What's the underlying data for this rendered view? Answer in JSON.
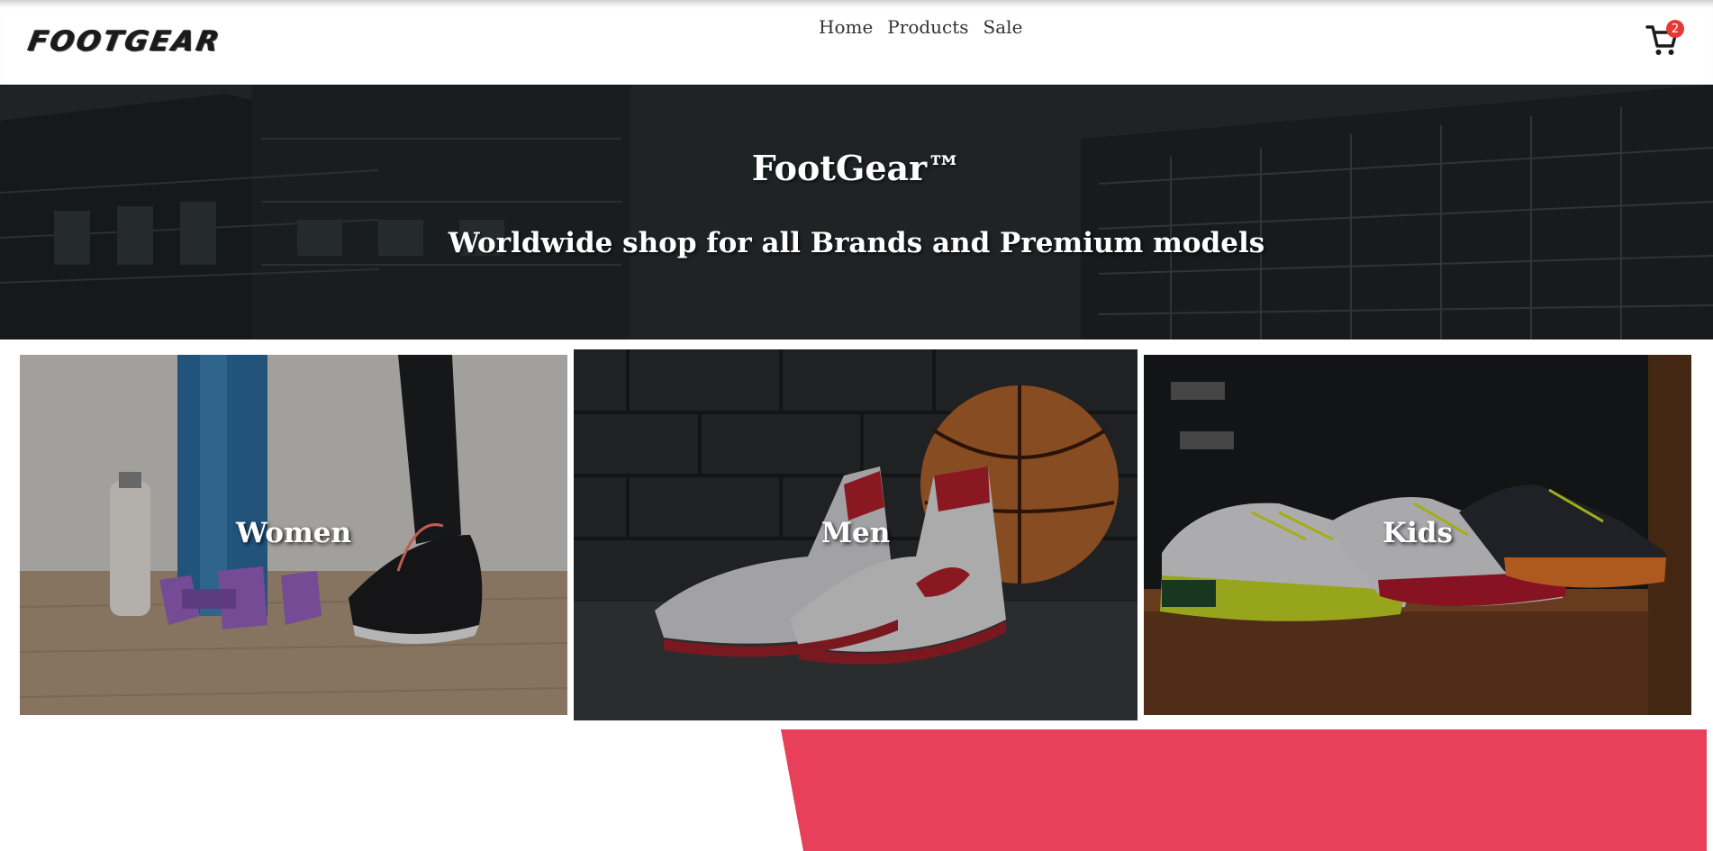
{
  "header": {
    "logo_text": "FOOTGEAR",
    "nav": {
      "home": "Home",
      "products": "Products",
      "sale": "Sale"
    },
    "cart": {
      "icon": "cart-icon",
      "count": "2"
    }
  },
  "hero": {
    "title": "FootGear™",
    "subtitle": "Worldwide shop for all Brands and Premium models"
  },
  "categories": {
    "women": "Women",
    "men": "Men",
    "kids": "Kids"
  },
  "colors": {
    "accent_banner": "#e8405a",
    "badge": "#e53935",
    "header_bg": "#ffffff"
  }
}
